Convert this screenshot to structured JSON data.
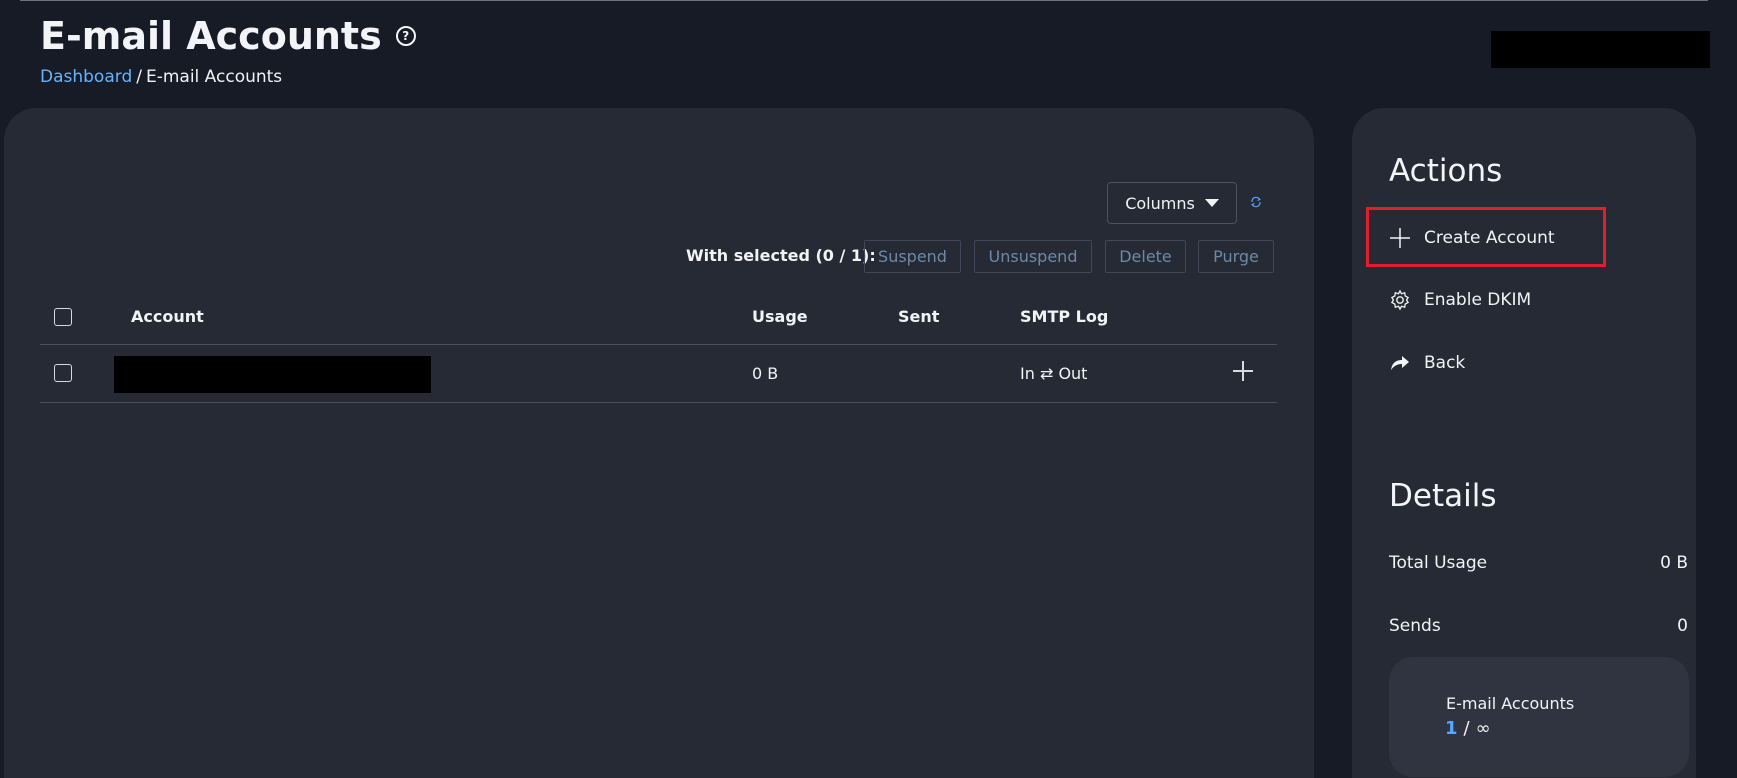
{
  "header": {
    "title": "E-mail Accounts",
    "help_icon": "question-circle-icon",
    "breadcrumb": {
      "home": "Dashboard",
      "separator": "/",
      "current": "E-mail Accounts"
    }
  },
  "table": {
    "toolbar": {
      "columns_label": "Columns",
      "with_selected": "With selected (0 / 1):",
      "suspend": "Suspend",
      "unsuspend": "Unsuspend",
      "delete": "Delete",
      "purge": "Purge"
    },
    "headers": {
      "account": "Account",
      "usage": "Usage",
      "sent": "Sent",
      "smtp_log": "SMTP Log"
    },
    "rows": [
      {
        "usage": "0 B",
        "sent": "",
        "smtp_log": "In ⇄ Out"
      }
    ]
  },
  "sidebar": {
    "actions_title": "Actions",
    "actions": [
      {
        "label": "Create Account",
        "icon": "plus-icon"
      },
      {
        "label": "Enable DKIM",
        "icon": "gear-icon"
      },
      {
        "label": "Back",
        "icon": "share-arrow-icon"
      }
    ],
    "details_title": "Details",
    "details": {
      "total_usage_label": "Total Usage",
      "total_usage_value": "0 B",
      "sends_label": "Sends",
      "sends_value": "0"
    },
    "quota": {
      "title": "E-mail Accounts",
      "used": "1",
      "separator": "/",
      "limit": "∞"
    }
  },
  "colors": {
    "accent": "#58a6ff",
    "highlight": "#df202c"
  }
}
